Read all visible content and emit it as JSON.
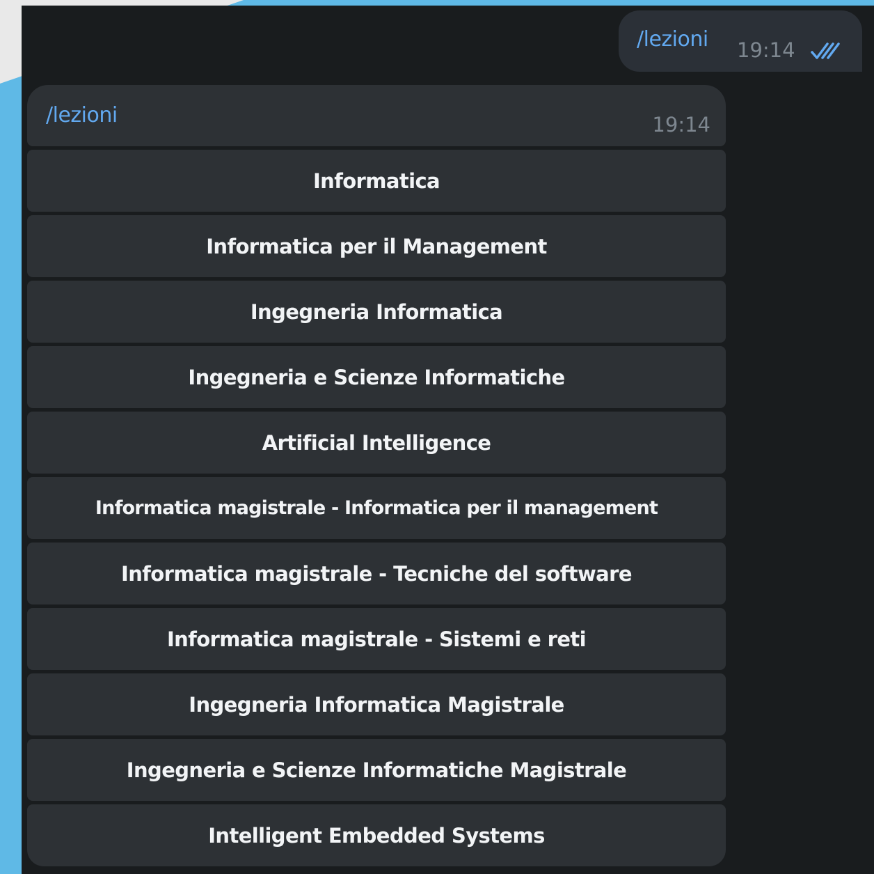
{
  "colors": {
    "chat_background": "#191c1e",
    "bubble": "#2d3135",
    "command_text": "#62a9f0",
    "button_text": "#f2f4f6",
    "timestamp": "#7e8790",
    "read_ticks": "#62a9f0"
  },
  "outgoing_message": {
    "text": "/lezioni",
    "time": "19:14",
    "status_icon": "double-check-icon"
  },
  "bot_message": {
    "text": "/lezioni",
    "time": "19:14"
  },
  "inline_keyboard": [
    {
      "label": "Informatica"
    },
    {
      "label": "Informatica per il Management"
    },
    {
      "label": "Ingegneria Informatica"
    },
    {
      "label": "Ingegneria e Scienze Informatiche"
    },
    {
      "label": "Artificial Intelligence"
    },
    {
      "label": "Informatica magistrale - Informatica per il management"
    },
    {
      "label": "Informatica magistrale - Tecniche del software"
    },
    {
      "label": "Informatica magistrale - Sistemi e reti"
    },
    {
      "label": "Ingegneria Informatica Magistrale"
    },
    {
      "label": "Ingegneria e Scienze Informatiche Magistrale"
    },
    {
      "label": "Intelligent Embedded Systems"
    }
  ]
}
